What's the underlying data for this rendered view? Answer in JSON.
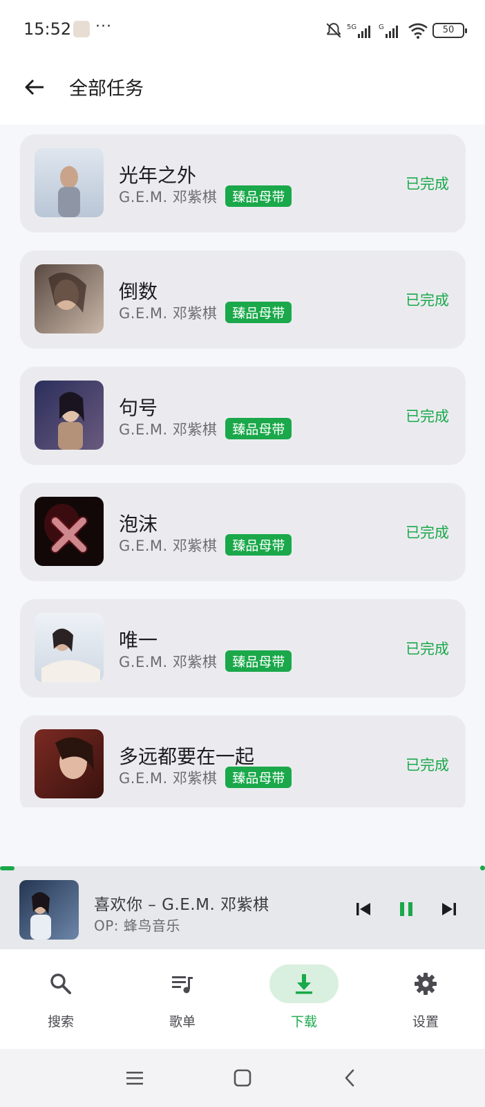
{
  "status_bar": {
    "time": "15:52",
    "more": "···",
    "battery": "50"
  },
  "header": {
    "title": "全部任务"
  },
  "tasks": [
    {
      "title": "光年之外",
      "artist": "G.E.M. 邓紫棋",
      "quality": "臻品母带",
      "status": "已完成",
      "cover_colors": [
        "#dfe6ef",
        "#b9c6d6"
      ]
    },
    {
      "title": "倒数",
      "artist": "G.E.M. 邓紫棋",
      "quality": "臻品母带",
      "status": "已完成",
      "cover_colors": [
        "#5a4a42",
        "#c9b7a8"
      ]
    },
    {
      "title": "句号",
      "artist": "G.E.M. 邓紫棋",
      "quality": "臻品母带",
      "status": "已完成",
      "cover_colors": [
        "#2b2f5c",
        "#b4927a"
      ]
    },
    {
      "title": "泡沫",
      "artist": "G.E.M. 邓紫棋",
      "quality": "臻品母带",
      "status": "已完成",
      "cover_colors": [
        "#120808",
        "#b3202a"
      ]
    },
    {
      "title": "唯一",
      "artist": "G.E.M. 邓紫棋",
      "quality": "臻品母带",
      "status": "已完成",
      "cover_colors": [
        "#eef2f7",
        "#cfd8e3"
      ]
    },
    {
      "title": "多远都要在一起",
      "artist": "G.E.M. 邓紫棋",
      "quality": "臻品母带",
      "status": "已完成",
      "cover_colors": [
        "#7a2a22",
        "#e2b9a2"
      ]
    }
  ],
  "player": {
    "title": "喜欢你 – G.E.M. 邓紫棋",
    "subtitle": "OP: 蜂鸟音乐",
    "progress": 0.03
  },
  "nav": {
    "items": [
      {
        "label": "搜索",
        "icon": "search-icon",
        "active": false
      },
      {
        "label": "歌单",
        "icon": "playlist-icon",
        "active": false
      },
      {
        "label": "下载",
        "icon": "download-icon",
        "active": true
      },
      {
        "label": "设置",
        "icon": "gear-icon",
        "active": false
      }
    ]
  },
  "colors": {
    "accent": "#1aa84a",
    "card": "#ebebef",
    "player_bg": "#e7e8ec"
  }
}
